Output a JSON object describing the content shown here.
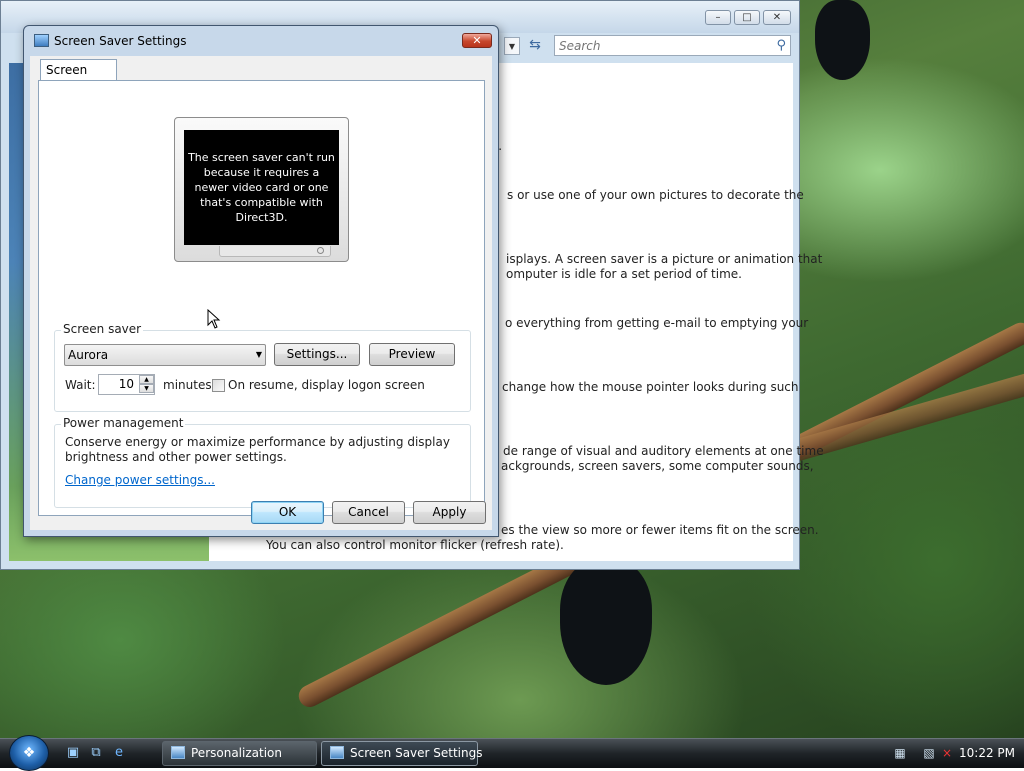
{
  "personalization_window": {
    "search_placeholder": "Search",
    "descriptions": [
      "s.",
      "s or use one of your own pictures to decorate the",
      "isplays. A screen saver is a picture or animation that",
      "omputer is idle for a set period of time.",
      "o everything from getting e-mail to emptying your",
      "change how the mouse pointer looks during such",
      "de range of visual and auditory elements at one time",
      "ackgrounds, screen savers, some computer sounds,",
      "es the view so more or fewer items fit on the screen.",
      "You can also control monitor flicker (refresh rate)."
    ]
  },
  "dialog": {
    "title": "Screen Saver Settings",
    "tab_label": "Screen Saver",
    "preview_message": "The screen saver can't run because it requires a newer video card or one that's compatible with Direct3D.",
    "screen_saver_group": {
      "legend": "Screen saver",
      "selected": "Aurora",
      "settings_label": "Settings...",
      "preview_label": "Preview",
      "wait_label": "Wait:",
      "wait_value": "10",
      "minutes_label": "minutes",
      "resume_label": "On resume, display logon screen"
    },
    "power_group": {
      "legend": "Power management",
      "text_line1": "Conserve energy or maximize performance by adjusting display",
      "text_line2": "brightness and other power settings.",
      "link": "Change power settings..."
    },
    "ok_label": "OK",
    "cancel_label": "Cancel",
    "apply_label": "Apply"
  },
  "taskbar": {
    "tasks": [
      "Personalization",
      "Screen Saver Settings"
    ],
    "clock": "10:22 PM"
  }
}
